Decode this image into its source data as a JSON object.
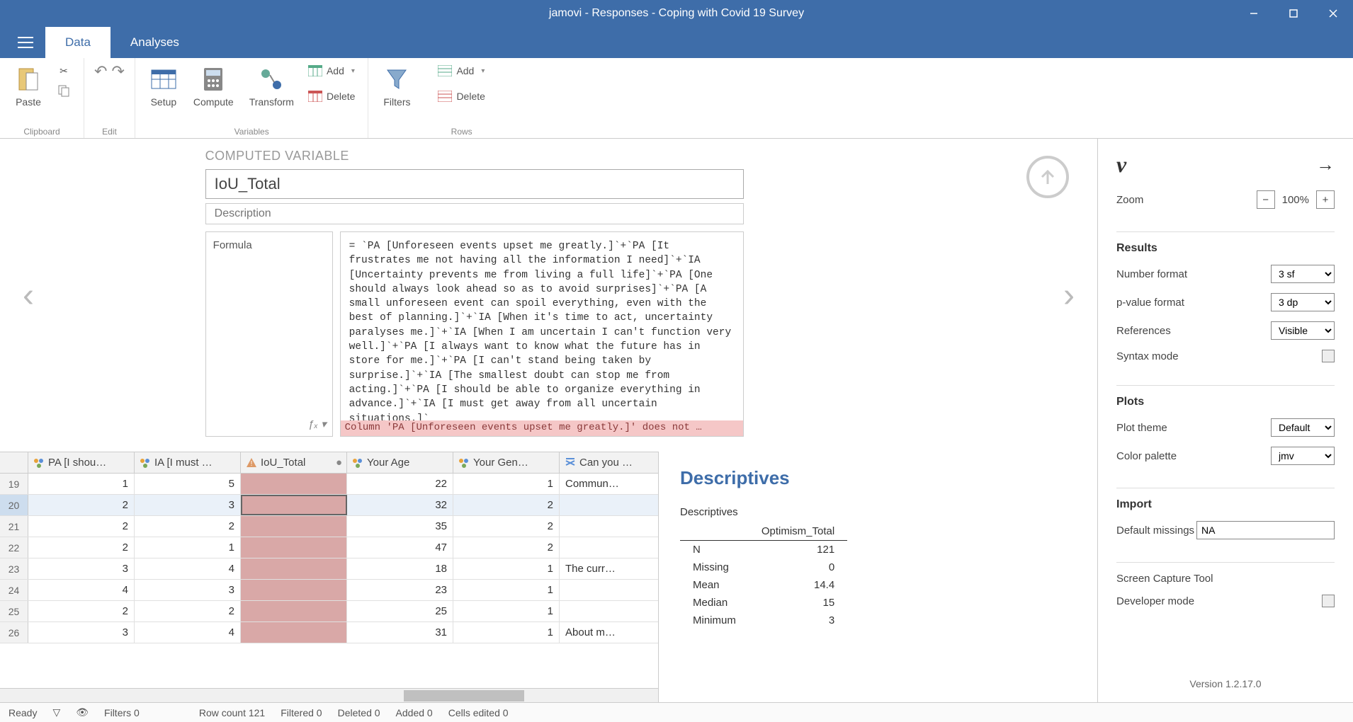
{
  "window": {
    "title": "jamovi - Responses - Coping with Covid 19 Survey"
  },
  "tabs": {
    "data": "Data",
    "analyses": "Analyses"
  },
  "ribbon": {
    "clipboard": {
      "paste": "Paste",
      "group": "Clipboard"
    },
    "edit": {
      "group": "Edit"
    },
    "variables": {
      "setup": "Setup",
      "compute": "Compute",
      "transform": "Transform",
      "add": "Add",
      "delete": "Delete",
      "group": "Variables"
    },
    "filters": {
      "filters": "Filters"
    },
    "rows": {
      "add": "Add",
      "delete": "Delete",
      "group": "Rows"
    }
  },
  "comp_var": {
    "heading": "COMPUTED VARIABLE",
    "name": "IoU_Total",
    "desc_placeholder": "Description",
    "formula_label": "Formula",
    "fx": "ƒₓ ▾",
    "formula": "= `PA [Unforeseen events upset me greatly.]`+`PA [It frustrates me not having all the information I need]`+`IA [Uncertainty prevents me from living a full life]`+`PA [One should always look ahead so as to avoid surprises]`+`PA [A small unforeseen event can spoil everything, even with the best of planning.]`+`IA [When it's time to act, uncertainty paralyses me.]`+`IA [When I am uncertain I can't function very well.]`+`PA [I always want to know what the future has in store for me.]`+`PA [I can't stand being taken by surprise.]`+`IA [The smallest doubt can stop me from acting.]`+`PA [I should be able to organize everything in advance.]`+`IA [I must get away from all uncertain situations.]`",
    "error": "Column 'PA [Unforeseen events upset me greatly.]' does not …"
  },
  "sheet": {
    "columns": [
      {
        "label": "PA [I shou…",
        "type": "nominal"
      },
      {
        "label": "IA [I must …",
        "type": "nominal"
      },
      {
        "label": "IoU_Total",
        "type": "computed"
      },
      {
        "label": "Your Age",
        "type": "nominal"
      },
      {
        "label": "Your Gen…",
        "type": "nominal"
      },
      {
        "label": "Can you …",
        "type": "text"
      }
    ],
    "rows": [
      {
        "n": 19,
        "c": [
          "1",
          "5",
          "",
          "22",
          "1",
          "Commun…"
        ]
      },
      {
        "n": 20,
        "c": [
          "2",
          "3",
          "",
          "32",
          "2",
          ""
        ],
        "sel": true
      },
      {
        "n": 21,
        "c": [
          "2",
          "2",
          "",
          "35",
          "2",
          ""
        ]
      },
      {
        "n": 22,
        "c": [
          "2",
          "1",
          "",
          "47",
          "2",
          ""
        ]
      },
      {
        "n": 23,
        "c": [
          "3",
          "4",
          "",
          "18",
          "1",
          "The curr…"
        ]
      },
      {
        "n": 24,
        "c": [
          "4",
          "3",
          "",
          "23",
          "1",
          ""
        ]
      },
      {
        "n": 25,
        "c": [
          "2",
          "2",
          "",
          "25",
          "1",
          ""
        ]
      },
      {
        "n": 26,
        "c": [
          "3",
          "4",
          "",
          "31",
          "1",
          "About m…"
        ]
      }
    ]
  },
  "results": {
    "title": "Descriptives",
    "subtitle": "Descriptives",
    "col": "Optimism_Total",
    "stats": [
      {
        "k": "N",
        "v": "121"
      },
      {
        "k": "Missing",
        "v": "0"
      },
      {
        "k": "Mean",
        "v": "14.4"
      },
      {
        "k": "Median",
        "v": "15"
      },
      {
        "k": "Minimum",
        "v": "3"
      }
    ]
  },
  "settings": {
    "zoom_label": "Zoom",
    "zoom_value": "100%",
    "results_h": "Results",
    "number_format_l": "Number format",
    "number_format_v": "3 sf",
    "pvalue_format_l": "p-value format",
    "pvalue_format_v": "3 dp",
    "references_l": "References",
    "references_v": "Visible",
    "syntax_l": "Syntax mode",
    "plots_h": "Plots",
    "plot_theme_l": "Plot theme",
    "plot_theme_v": "Default",
    "color_palette_l": "Color palette",
    "color_palette_v": "jmv",
    "import_h": "Import",
    "default_missings_l": "Default missings",
    "default_missings_v": "NA",
    "screen_capture": "Screen Capture Tool",
    "dev_mode": "Developer mode",
    "version": "Version 1.2.17.0"
  },
  "status": {
    "ready": "Ready",
    "filters": "Filters 0",
    "row_count": "Row count 121",
    "filtered": "Filtered 0",
    "deleted": "Deleted 0",
    "added": "Added 0",
    "cells_edited": "Cells edited 0"
  }
}
